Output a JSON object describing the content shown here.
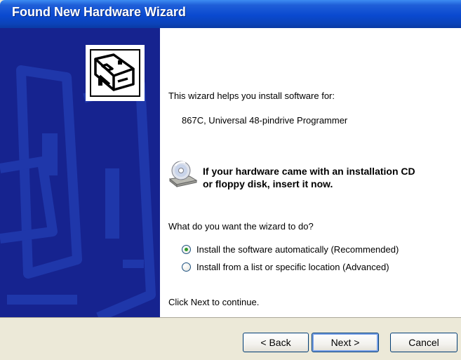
{
  "window": {
    "title": "Found New Hardware Wizard"
  },
  "content": {
    "intro": "This wizard helps you install software for:",
    "device_name": "867C, Universal 48-pindrive Programmer",
    "cd_message_line1": "If your hardware came with an installation CD",
    "cd_message_line2": "or floppy disk, insert it now.",
    "question": "What do you want the wizard to do?",
    "options": [
      {
        "label": "Install the software automatically (Recommended)",
        "selected": true
      },
      {
        "label": "Install from a list or specific location (Advanced)",
        "selected": false
      }
    ],
    "continue_text": "Click Next to continue."
  },
  "buttons": {
    "back": "< Back",
    "next": "Next >",
    "cancel": "Cancel"
  },
  "colors": {
    "titlebar": "#0a49d0",
    "left_panel": "#16238f",
    "face": "#ece9d8"
  },
  "icons": {
    "wizard": "hardware-card-icon",
    "cd": "cd-drive-icon"
  }
}
